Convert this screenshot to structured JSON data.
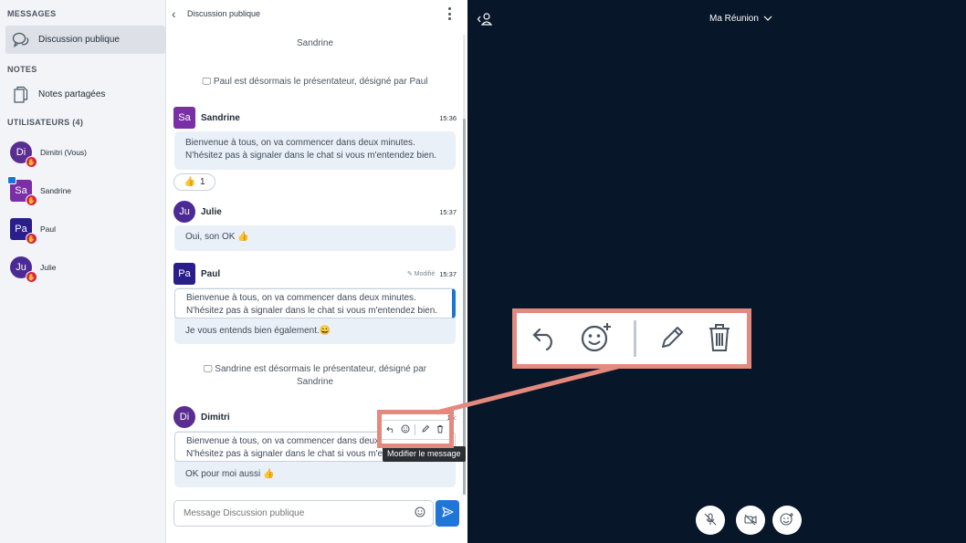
{
  "sidebar": {
    "messages_title": "MESSAGES",
    "public_chat_label": "Discussion publique",
    "notes_title": "NOTES",
    "shared_notes_label": "Notes partagées",
    "users_title": "UTILISATEURS (4)",
    "users": [
      {
        "initials": "Di",
        "name": "Dimitri (Vous)",
        "color": "#5a2d91",
        "shape": "round"
      },
      {
        "initials": "Sa",
        "name": "Sandrine",
        "color": "#7b2fa6",
        "shape": "square"
      },
      {
        "initials": "Pa",
        "name": "Paul",
        "color": "#2a1d8c",
        "shape": "square"
      },
      {
        "initials": "Ju",
        "name": "Julie",
        "color": "#4c2a96",
        "shape": "round"
      }
    ]
  },
  "chat": {
    "title": "Discussion publique",
    "top_partial_name": "Sandrine",
    "system_1": "Paul est désormais le présentateur, désigné par Paul",
    "system_2_line1": "Sandrine est désormais le présentateur, désigné par",
    "system_2_line2": "Sandrine",
    "messages": [
      {
        "initials": "Sa",
        "sender": "Sandrine",
        "time": "15:36",
        "color": "#7b2fa6",
        "line1": "Bienvenue à tous, on va commencer dans deux minutes.",
        "line2": "N'hésitez pas à signaler dans le chat si vous m'entendez bien."
      },
      {
        "initials": "Ju",
        "sender": "Julie",
        "time": "15:37",
        "color": "#4c2a96",
        "text": "Oui, son OK 👍"
      },
      {
        "initials": "Pa",
        "sender": "Paul",
        "time": "15:37",
        "edited": "Modifié",
        "color": "#2a1d8c",
        "quote1": "Bienvenue à tous, on va commencer dans deux minutes.",
        "quote2": "N'hésitez pas à signaler dans le chat si vous m'entendez bien.",
        "text": "Je vous entends bien également.😀"
      },
      {
        "initials": "Di",
        "sender": "Dimitri",
        "time": "15:",
        "color": "#5a2d91",
        "quote1": "Bienvenue à tous, on va commencer dans deux",
        "quote2": "N'hésitez pas à signaler dans le chat si vous m'en",
        "text": "OK pour moi aussi 👍"
      }
    ],
    "reaction": {
      "emoji": "👍",
      "count": "1"
    },
    "tooltip": "Modifier le message",
    "composer_placeholder": "Message Discussion publique"
  },
  "main": {
    "meeting_title": "Ma Réunion"
  }
}
